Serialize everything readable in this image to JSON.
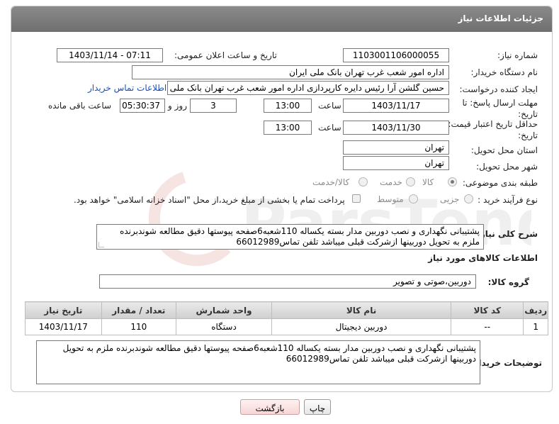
{
  "panel": {
    "title": "جزئیات اطلاعات نیاز"
  },
  "labels": {
    "need_number": "شماره نیاز:",
    "announce_datetime": "تاریخ و ساعت اعلان عمومی:",
    "buyer_org": "نام دستگاه خریدار:",
    "requester": "ایجاد کننده درخواست:",
    "reply_deadline": "مهلت ارسال پاسخ: تا تاریخ:",
    "price_validity": "حداقل تاریخ اعتبار قیمت: تا تاریخ:",
    "time": "ساعت",
    "day_and": "روز و",
    "time_remaining": "ساعت باقی مانده",
    "province": "استان محل تحویل:",
    "city": "شهر محل تحویل:",
    "category": "طبقه بندی موضوعی:",
    "purchase_type": "نوع فرآیند خرید :",
    "general_desc": "شرح کلی نیاز:",
    "goods_info": "اطلاعات کالاهای مورد نیاز",
    "goods_group": "گروه کالا:",
    "buyer_notes": "توضیحات خریدار:"
  },
  "fields": {
    "need_number": "1103001106000055",
    "announce_datetime": "1403/11/14 - 07:11",
    "buyer_org": "اداره امور شعب غرب تهران بانک ملی ایران",
    "requester": "حسین گلشن آرا رئیس دایره کارپردازی اداره امور شعب غرب تهران بانک ملی ایرا",
    "contact_link": "اطلاعات تماس خریدار",
    "reply_date": "1403/11/17",
    "reply_time": "13:00",
    "reply_days": "3",
    "reply_remaining": "05:30:37",
    "validity_date": "1403/11/30",
    "validity_time": "13:00",
    "province": "تهران",
    "city": "تهران",
    "goods_group": "دوربین،صوتی و تصویر"
  },
  "category_options": [
    "کالا",
    "خدمت",
    "کالا/خدمت"
  ],
  "purchase_options": [
    "جزیی",
    "متوسط"
  ],
  "payment_note": "پرداخت تمام یا بخشی از مبلغ خرید،از محل \"اسناد خزانه اسلامی\" خواهد بود.",
  "general_desc_text": "پشتیبانی نگهداری و نصب دوربین مدار بسته یکساله 110شعبه6صفحه پیوستها دقیق مطالعه شوندبرنده ملزم به تحویل دوربینها ازشرکت قبلی میباشد تلفن تماس66012989",
  "table": {
    "headers": [
      "ردیف",
      "کد کالا",
      "نام کالا",
      "واحد شمارش",
      "تعداد / مقدار",
      "تاریخ نیاز"
    ],
    "rows": [
      [
        "1",
        "--",
        "دوربین دیجیتال",
        "دستگاه",
        "110",
        "1403/11/17"
      ]
    ]
  },
  "buyer_notes_text": "پشتیبانی نگهداری و نصب دوربین مدار بسته یکساله 110شعبه6صفحه پیوستها دقیق مطالعه شوندبرنده ملزم به تحویل دوربینها ازشرکت قبلی میباشد تلفن تماس66012989",
  "buttons": {
    "print": "چاپ",
    "back": "بازگشت"
  },
  "watermark_text": "ParsTender"
}
